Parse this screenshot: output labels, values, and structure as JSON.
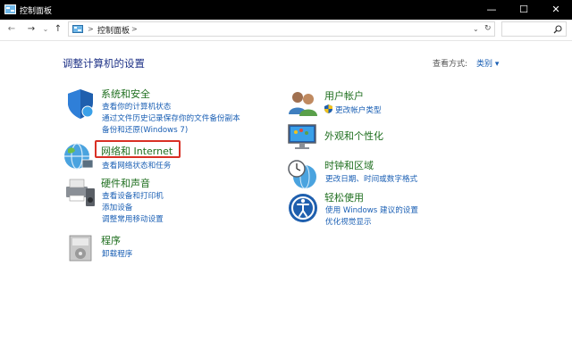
{
  "window": {
    "title": "控制面板"
  },
  "window_controls": {
    "minimize": "—",
    "maximize": "☐",
    "close": "✕"
  },
  "nav": {
    "back": "←",
    "forward": "→",
    "recent": "⌄",
    "up": "↑"
  },
  "address": {
    "separator1": ">",
    "crumb": "控制面板",
    "separator2": ">",
    "dropdown": "⌄",
    "refresh": "↻"
  },
  "search": {
    "placeholder": "",
    "icon": "search-icon"
  },
  "heading": "调整计算机的设置",
  "view_by": {
    "label": "查看方式:",
    "value": "类别 ▾"
  },
  "left_categories": [
    {
      "icon": "shield-icon",
      "title": "系统和安全",
      "links": [
        "查看你的计算机状态",
        "通过文件历史记录保存你的文件备份副本",
        "备份和还原(Windows 7)"
      ]
    },
    {
      "icon": "globe-network-icon",
      "title": "网络和 Internet",
      "highlighted": true,
      "links": [
        "查看网络状态和任务"
      ]
    },
    {
      "icon": "printer-speaker-icon",
      "title": "硬件和声音",
      "links": [
        "查看设备和打印机",
        "添加设备",
        "调整常用移动设置"
      ]
    },
    {
      "icon": "programs-icon",
      "title": "程序",
      "links": [
        "卸载程序"
      ]
    }
  ],
  "right_categories": [
    {
      "icon": "users-icon",
      "title": "用户帐户",
      "links": [
        "更改帐户类型"
      ]
    },
    {
      "icon": "monitor-paint-icon",
      "title": "外观和个性化",
      "links": []
    },
    {
      "icon": "clock-globe-icon",
      "title": "时钟和区域",
      "links": [
        "更改日期、时间或数字格式"
      ]
    },
    {
      "icon": "ease-of-access-icon",
      "title": "轻松使用",
      "links": [
        "使用 Windows 建议的设置",
        "优化视觉显示"
      ]
    }
  ],
  "colors": {
    "title_bar": "#000000",
    "heading": "#1e3287",
    "category_title": "#1e6e1e",
    "link": "#1a5fb4",
    "highlight_box": "#d93025"
  }
}
